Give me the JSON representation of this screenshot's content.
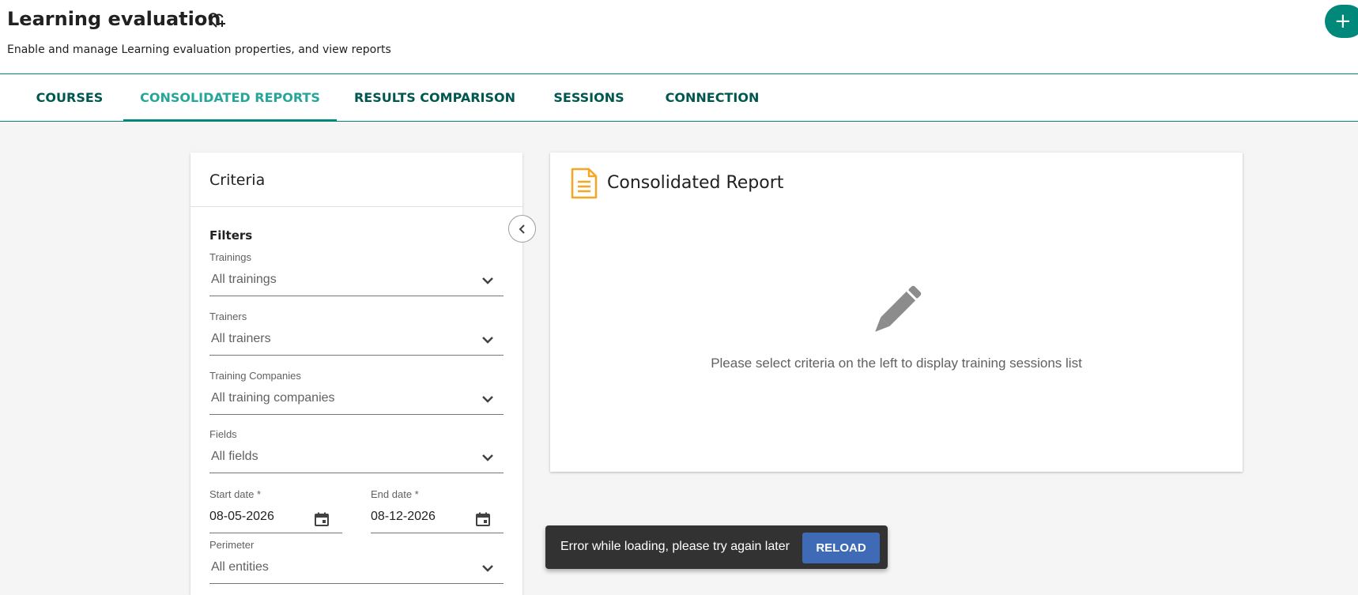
{
  "header": {
    "title": "Learning evaluation",
    "subtitle": "Enable and manage Learning evaluation properties, and view reports",
    "add_label": "+"
  },
  "tabs": [
    {
      "label": "COURSES",
      "active": false
    },
    {
      "label": "CONSOLIDATED REPORTS",
      "active": true
    },
    {
      "label": "RESULTS COMPARISON",
      "active": false
    },
    {
      "label": "SESSIONS",
      "active": false
    },
    {
      "label": "CONNECTION",
      "active": false
    }
  ],
  "criteria": {
    "title": "Criteria",
    "filters_title": "Filters",
    "trainings": {
      "label": "Trainings",
      "value": "All trainings"
    },
    "trainers": {
      "label": "Trainers",
      "value": "All trainers"
    },
    "companies": {
      "label": "Training Companies",
      "value": "All training companies"
    },
    "fields": {
      "label": "Fields",
      "value": "All fields"
    },
    "start_date": {
      "label": "Start date *",
      "value": "08-05-2026"
    },
    "end_date": {
      "label": "End date *",
      "value": "08-12-2026"
    },
    "perimeter": {
      "label": "Perimeter",
      "value": "All entities"
    }
  },
  "report": {
    "title": "Consolidated Report",
    "empty_message": "Please select criteria on the left to display training sessions list"
  },
  "snackbar": {
    "message": "Error while loading, please try again later",
    "action_label": "RELOAD"
  },
  "colors": {
    "accent": "#00897b",
    "active_tab": "#26a69a",
    "tab_text": "#00574f",
    "report_icon": "#f5a623",
    "snackbar_bg": "#323232",
    "reload_button": "#3f6ab5"
  },
  "icons": {
    "favorite": "heart-plus-icon",
    "collapse": "chevron-left-icon",
    "select": "chevron-down-icon",
    "date": "calendar-icon",
    "report": "document-icon",
    "empty": "pencil-icon"
  }
}
